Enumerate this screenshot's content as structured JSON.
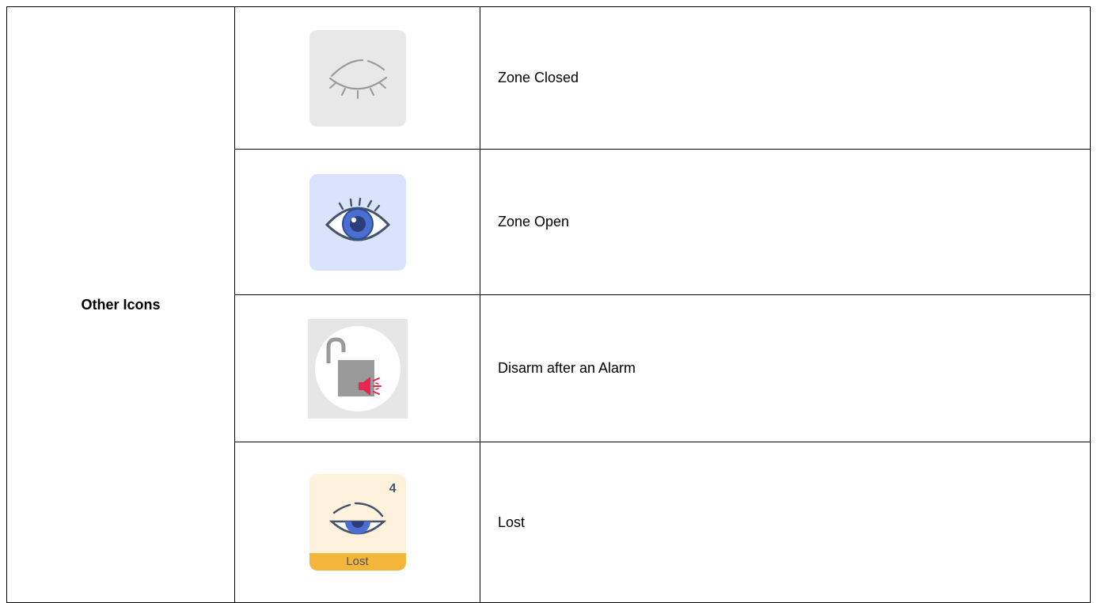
{
  "table": {
    "category": "Other Icons",
    "rows": [
      {
        "icon": "zone-closed-icon",
        "description": "Zone Closed"
      },
      {
        "icon": "zone-open-icon",
        "description": "Zone Open"
      },
      {
        "icon": "disarm-after-alarm-icon",
        "description": "Disarm after an Alarm"
      },
      {
        "icon": "lost-zone-icon",
        "description": "Lost",
        "badge_count": "4",
        "badge_label": "Lost"
      }
    ]
  },
  "colors": {
    "closed_tile": "#e8e8e8",
    "open_tile": "#d9e3fc",
    "lost_tile": "#fff2dc",
    "lost_banner": "#f4b63a",
    "alarm_red": "#e8264d",
    "eye_blue": "#4a6fd1"
  }
}
